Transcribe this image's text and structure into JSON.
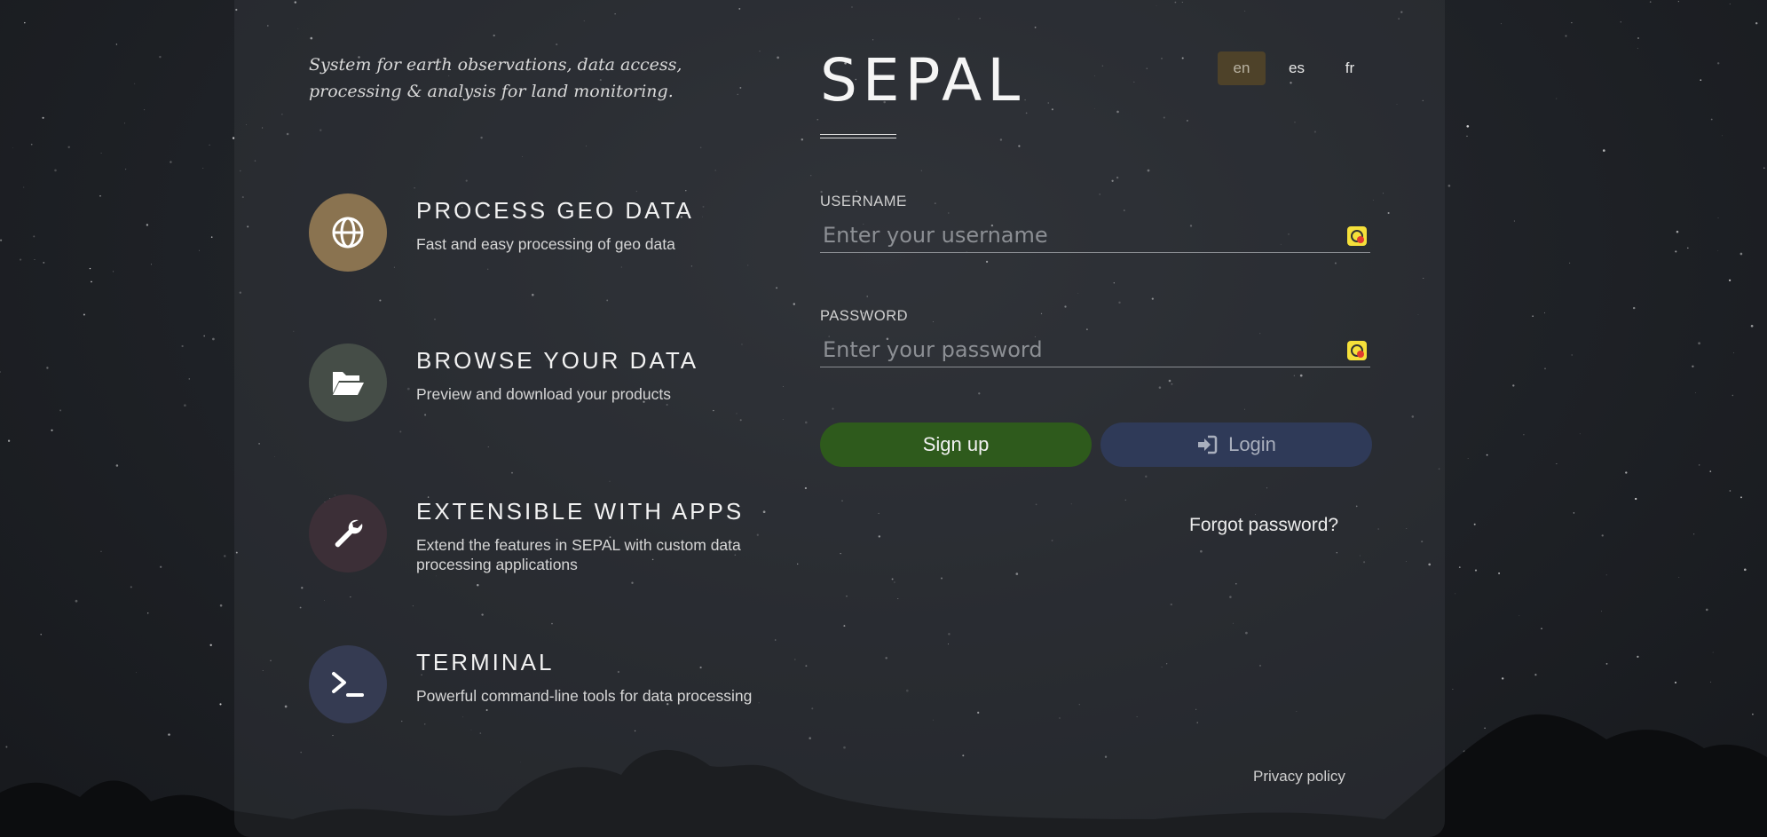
{
  "tagline": "System for earth observations, data access, processing & analysis for land monitoring.",
  "features": [
    {
      "title": "PROCESS GEO DATA",
      "description": "Fast and easy processing of geo data",
      "icon": "globe-icon",
      "color": "#8a7350"
    },
    {
      "title": "BROWSE YOUR DATA",
      "description": "Preview and download your products",
      "icon": "folder-open-icon",
      "color": "#454d47"
    },
    {
      "title": "EXTENSIBLE WITH APPS",
      "description": "Extend the features in SEPAL with custom data processing applications",
      "icon": "wrench-icon",
      "color": "#3c2f37"
    },
    {
      "title": "TERMINAL",
      "description": "Powerful command-line tools for data processing",
      "icon": "terminal-icon",
      "color": "#353b52"
    }
  ],
  "app": {
    "title": "SEPAL"
  },
  "languages": [
    {
      "code": "en",
      "active": true
    },
    {
      "code": "es",
      "active": false
    },
    {
      "code": "fr",
      "active": false
    }
  ],
  "form": {
    "username_label": "USERNAME",
    "username_placeholder": "Enter your username",
    "username_value": "",
    "password_label": "PASSWORD",
    "password_placeholder": "Enter your password",
    "password_value": "",
    "signup_label": "Sign up",
    "login_label": "Login",
    "login_icon": "sign-in-icon",
    "forgot_label": "Forgot password?"
  },
  "footer": {
    "privacy_label": "Privacy policy"
  },
  "colors": {
    "signup": "#2e5a1c",
    "login": "#2f3a58",
    "active_language": "#4e4229",
    "password_manager_icon": "#f5e03a"
  }
}
